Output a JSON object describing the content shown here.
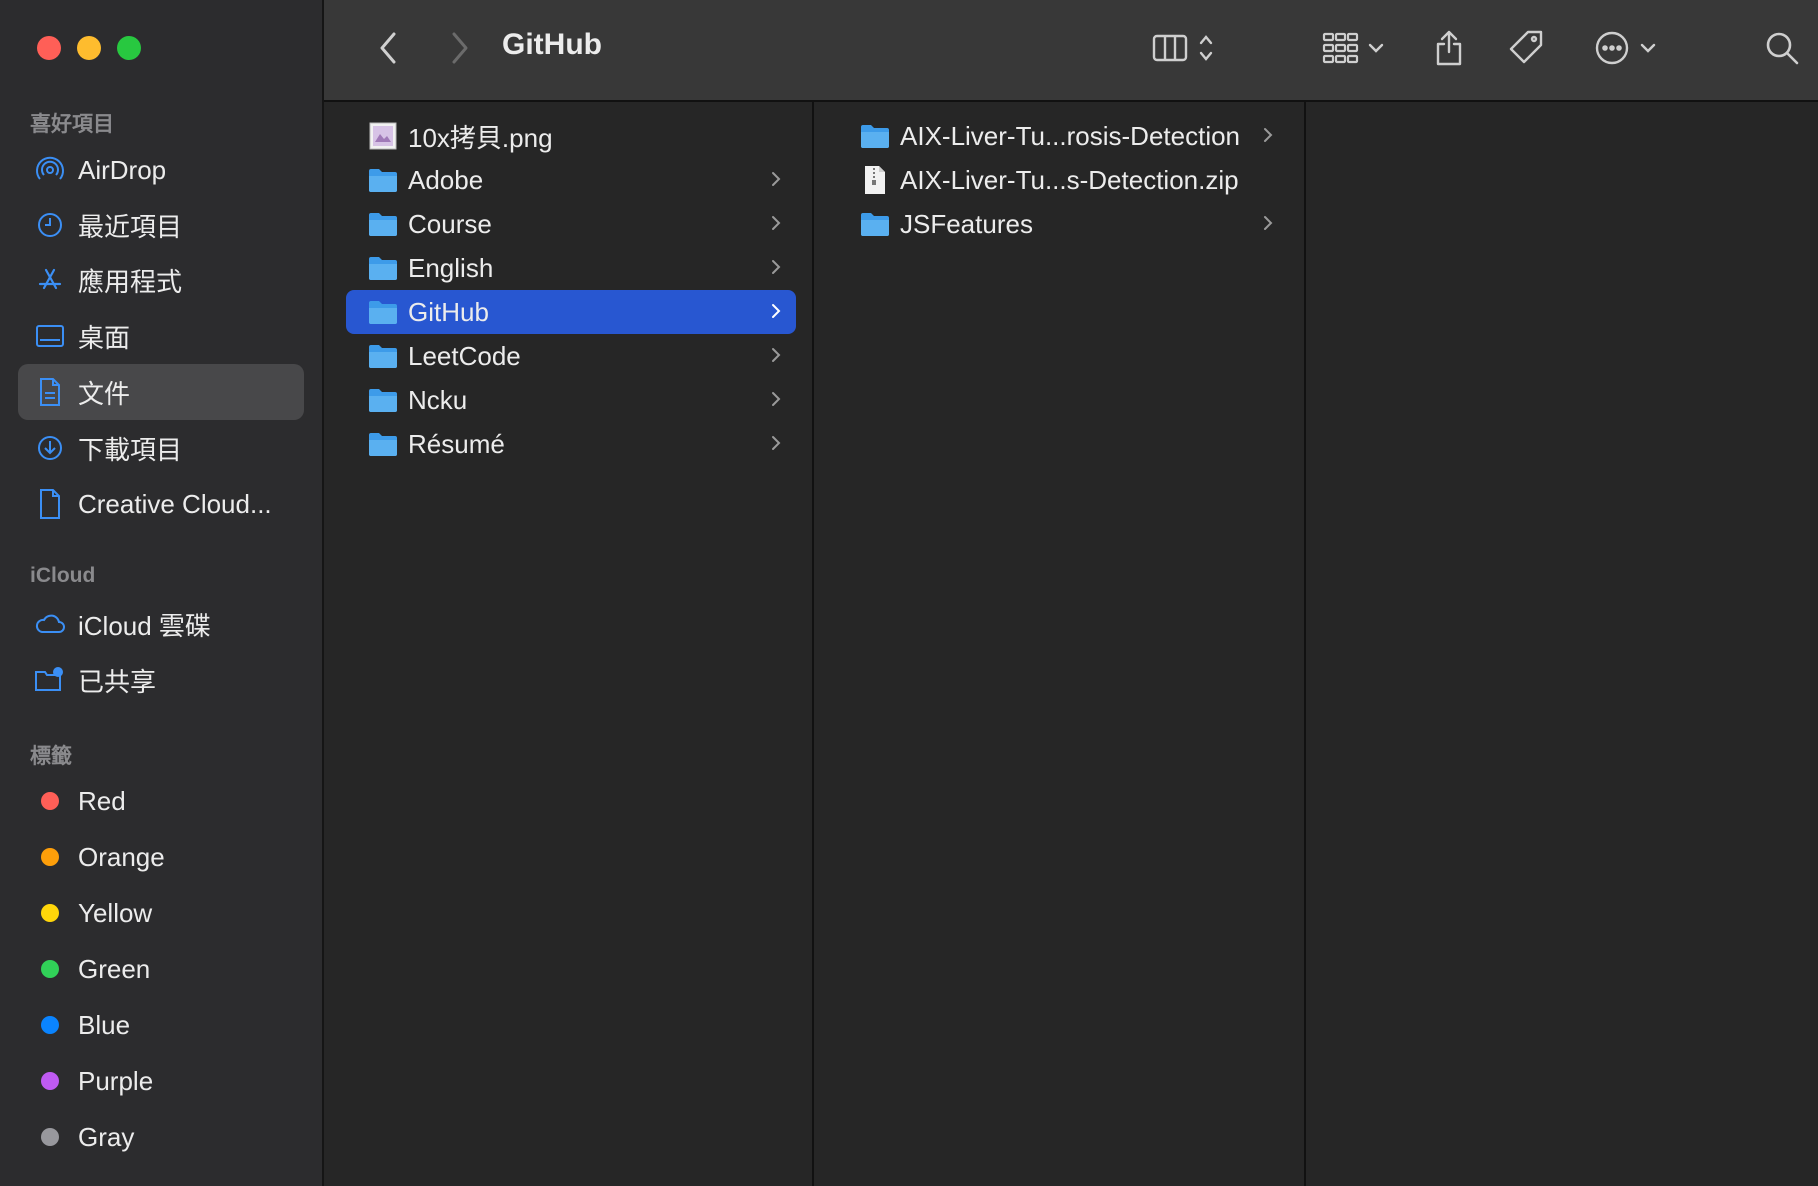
{
  "window": {
    "title": "GitHub"
  },
  "sidebar": {
    "sections": {
      "favorites": "喜好項目",
      "icloud": "iCloud",
      "tags": "標籤"
    },
    "favorites": [
      {
        "label": "AirDrop",
        "icon": "airdrop-icon"
      },
      {
        "label": "最近項目",
        "icon": "clock-icon"
      },
      {
        "label": "應用程式",
        "icon": "applications-icon"
      },
      {
        "label": "桌面",
        "icon": "desktop-icon"
      },
      {
        "label": "文件",
        "icon": "document-icon",
        "active": true
      },
      {
        "label": "下載項目",
        "icon": "download-icon"
      },
      {
        "label": "Creative Cloud...",
        "icon": "file-icon"
      }
    ],
    "icloud": [
      {
        "label": "iCloud 雲碟",
        "icon": "cloud-icon"
      },
      {
        "label": "已共享",
        "icon": "shared-folder-icon"
      }
    ],
    "tags": [
      {
        "label": "Red",
        "color": "#ff5f57"
      },
      {
        "label": "Orange",
        "color": "#fe9f0a"
      },
      {
        "label": "Yellow",
        "color": "#ffd60a"
      },
      {
        "label": "Green",
        "color": "#31d158"
      },
      {
        "label": "Blue",
        "color": "#0a84ff"
      },
      {
        "label": "Purple",
        "color": "#bf5af2"
      },
      {
        "label": "Gray",
        "color": "#98989d"
      }
    ]
  },
  "toolbar": {
    "back": "chevron-left-icon",
    "forward": "chevron-right-icon",
    "view": "column-view-icon",
    "group": "group-icon",
    "share": "share-icon",
    "tag": "tag-icon",
    "more": "more-icon",
    "search": "search-icon"
  },
  "columns": {
    "col1": [
      {
        "name": "10x拷貝.png",
        "type": "image"
      },
      {
        "name": "Adobe",
        "type": "folder"
      },
      {
        "name": "Course",
        "type": "folder"
      },
      {
        "name": "English",
        "type": "folder"
      },
      {
        "name": "GitHub",
        "type": "folder",
        "selected": true
      },
      {
        "name": "LeetCode",
        "type": "folder"
      },
      {
        "name": "Ncku",
        "type": "folder"
      },
      {
        "name": "Résumé",
        "type": "folder"
      }
    ],
    "col2": [
      {
        "name": "AIX-Liver-Tu...rosis-Detection",
        "type": "folder"
      },
      {
        "name": "AIX-Liver-Tu...s-Detection.zip",
        "type": "zip"
      },
      {
        "name": "JSFeatures",
        "type": "folder"
      }
    ]
  },
  "colors": {
    "accent": "#2857d1",
    "folder": "#5ab0f0",
    "sidebar_icon": "#3b8ff5"
  }
}
